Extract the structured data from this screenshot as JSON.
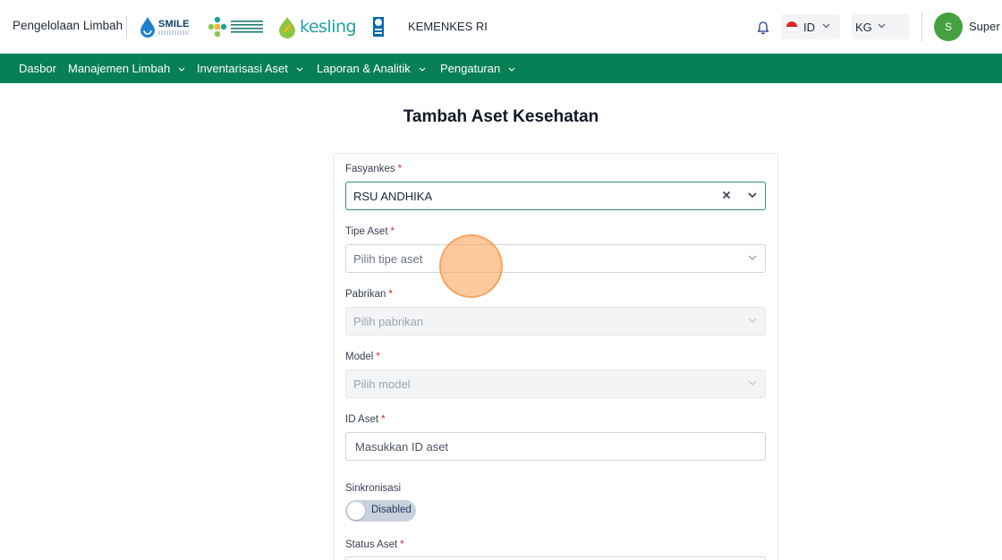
{
  "header": {
    "app_title": "Pengelolaan Limbah",
    "logos": {
      "smile": {
        "name": "SMILE"
      },
      "kesling": {
        "name": "kesling"
      }
    },
    "org_name": "KEMENKES RI",
    "language": {
      "selected": "ID"
    },
    "unit": {
      "selected": "KG"
    },
    "user": {
      "initial": "S",
      "name": "Super Admin"
    }
  },
  "nav": {
    "items": [
      {
        "label": "Dasbor",
        "has_dropdown": false
      },
      {
        "label": "Manajemen Limbah",
        "has_dropdown": true
      },
      {
        "label": "Inventarisasi Aset",
        "has_dropdown": true
      },
      {
        "label": "Laporan & Analitik",
        "has_dropdown": true
      },
      {
        "label": "Pengaturan",
        "has_dropdown": true
      }
    ]
  },
  "page": {
    "title": "Tambah Aset Kesehatan"
  },
  "form": {
    "fasyankes": {
      "label": "Fasyankes",
      "value": "RSU ANDHIKA"
    },
    "tipe_aset": {
      "label": "Tipe Aset",
      "placeholder": "Pilih tipe aset"
    },
    "pabrikan": {
      "label": "Pabrikan",
      "placeholder": "Pilih pabrikan"
    },
    "model": {
      "label": "Model",
      "placeholder": "Pilih model"
    },
    "id_aset": {
      "label": "ID Aset",
      "placeholder": "Masukkan ID aset"
    },
    "sinkronisasi": {
      "label": "Sinkronisasi",
      "state": "Disabled"
    },
    "status_aset": {
      "label": "Status Aset"
    },
    "required_mark": "*"
  },
  "colors": {
    "nav_bg": "#077f55",
    "avatar_bg": "#45a03f",
    "focus_border": "#3a8f73",
    "required": "#dc2626"
  }
}
